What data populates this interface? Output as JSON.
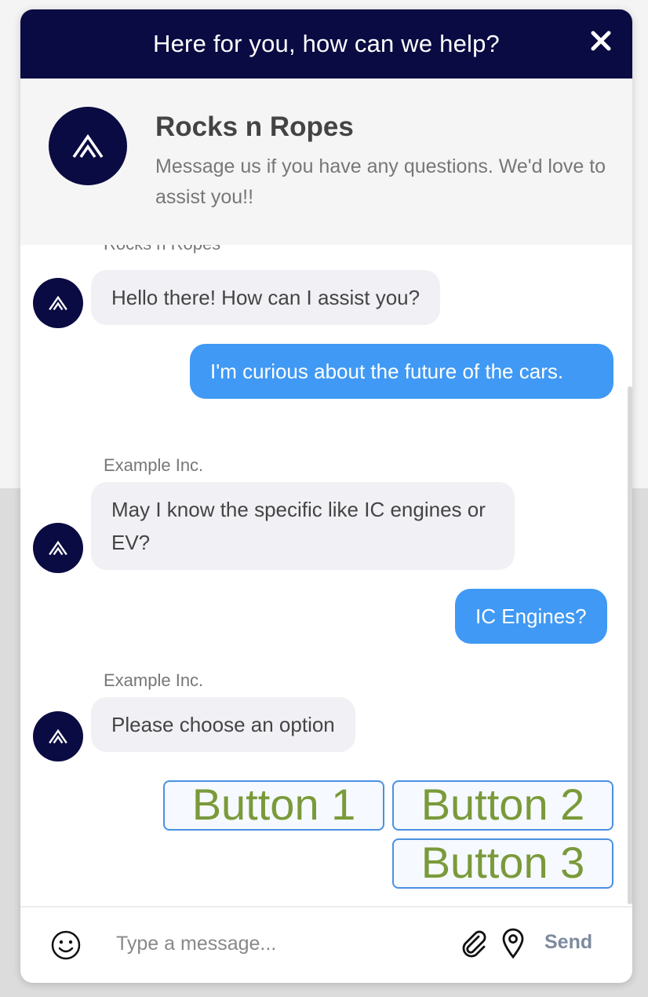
{
  "header": {
    "title": "Here for you, how can we help?",
    "close_icon": "close-icon"
  },
  "profile": {
    "name": "Rocks n Ropes",
    "description": "Message us if you have any questions. We'd love to assist you!!"
  },
  "messages": [
    {
      "sender": "Rocks n Ropes",
      "direction": "in",
      "text": "Hello there! How can I assist you?"
    },
    {
      "direction": "out",
      "text": "I'm curious about the future of the cars."
    },
    {
      "sender": "Example Inc.",
      "direction": "in",
      "text": "May I know the specific like IC engines or EV?"
    },
    {
      "direction": "out",
      "text": "IC Engines?"
    },
    {
      "sender": "Example Inc.",
      "direction": "in",
      "text": "Please choose an option"
    }
  ],
  "options": [
    "Button 1",
    "Button 2",
    "Button 3"
  ],
  "composer": {
    "placeholder": "Type a message...",
    "send_label": "Send"
  },
  "colors": {
    "brand_navy": "#0b0b43",
    "user_bubble": "#4099f4",
    "agent_bubble": "#f1f0f4",
    "option_text": "#7a9a3a",
    "option_border": "#4a90e2"
  }
}
